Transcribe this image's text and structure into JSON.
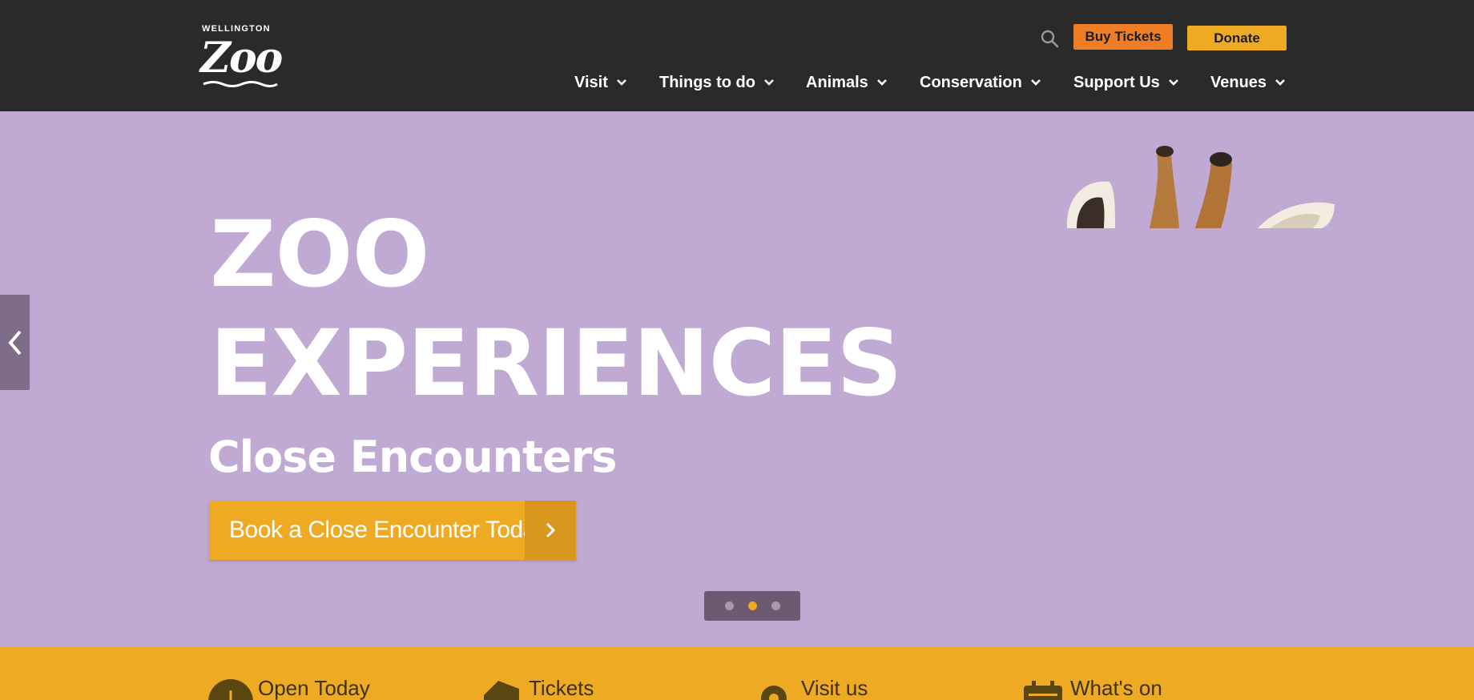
{
  "header": {
    "logo_small": "WELLINGTON",
    "logo_big": "Zoo",
    "buy_tickets": "Buy Tickets",
    "donate": "Donate",
    "nav": [
      {
        "label": "Visit"
      },
      {
        "label": "Things to do"
      },
      {
        "label": "Animals"
      },
      {
        "label": "Conservation"
      },
      {
        "label": "Support Us"
      },
      {
        "label": "Venues"
      }
    ]
  },
  "hero": {
    "title_line1": "ZOO",
    "title_line2": "EXPERIENCES",
    "subtitle": "Close Encounters",
    "cta": "Book a Close Encounter Today",
    "slides_total": 3,
    "active_slide": 2
  },
  "infobar": [
    {
      "label": "Open Today",
      "icon": "clock-icon"
    },
    {
      "label": "Tickets",
      "icon": "ticket-icon"
    },
    {
      "label": "Visit us",
      "icon": "location-pin-icon"
    },
    {
      "label": "What's on",
      "icon": "calendar-icon"
    }
  ],
  "colors": {
    "header_bg": "#2a2a2a",
    "hero_bg": "#c0a9d2",
    "accent_orange": "#ee7d25",
    "accent_yellow": "#eeaa22"
  }
}
